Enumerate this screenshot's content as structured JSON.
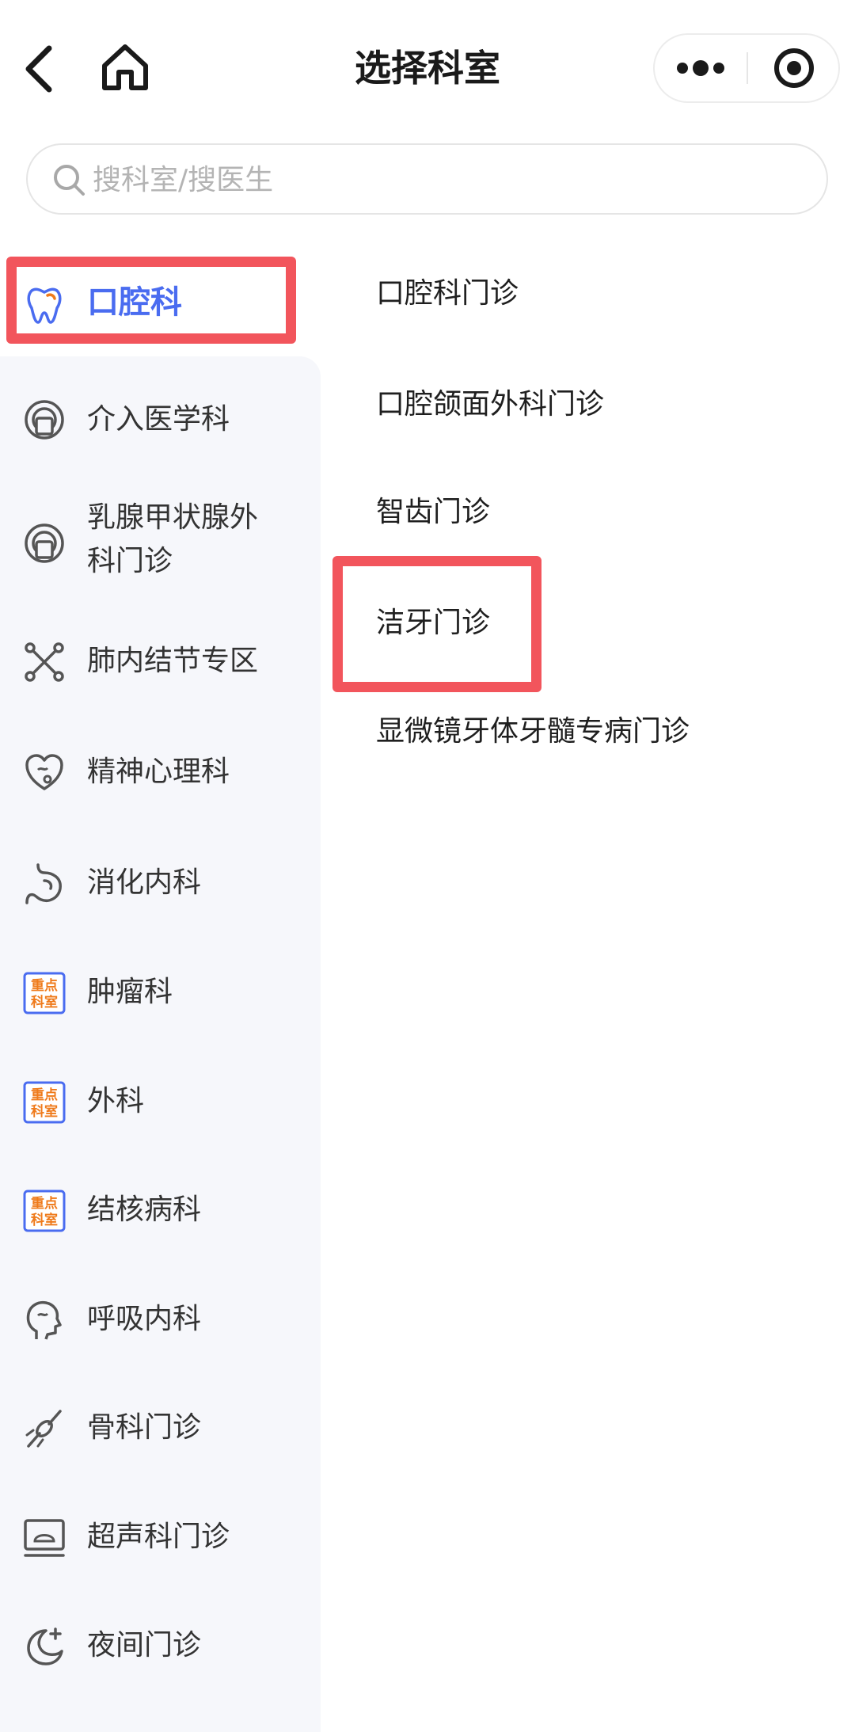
{
  "header": {
    "title": "选择科室"
  },
  "search": {
    "placeholder": "搜科室/搜医生"
  },
  "sidebar": {
    "items": [
      {
        "label": "口腔科",
        "icon": "tooth-icon",
        "active": true
      },
      {
        "label": "介入医学科",
        "icon": "ct-scanner-icon"
      },
      {
        "label": "乳腺甲状腺外科门诊",
        "icon": "ct-scanner-icon"
      },
      {
        "label": "肺内结节专区",
        "icon": "molecule-icon"
      },
      {
        "label": "精神心理科",
        "icon": "heart-brain-icon"
      },
      {
        "label": "消化内科",
        "icon": "stomach-icon"
      },
      {
        "label": "肿瘤科",
        "icon": "key-department-badge-icon"
      },
      {
        "label": "外科",
        "icon": "key-department-badge-icon"
      },
      {
        "label": "结核病科",
        "icon": "key-department-badge-icon"
      },
      {
        "label": "呼吸内科",
        "icon": "head-profile-icon"
      },
      {
        "label": "骨科门诊",
        "icon": "bone-icon"
      },
      {
        "label": "超声科门诊",
        "icon": "ultrasound-monitor-icon"
      },
      {
        "label": "夜间门诊",
        "icon": "moon-plus-icon"
      }
    ],
    "badge_text": [
      "重点",
      "科室"
    ]
  },
  "departments": [
    {
      "label": "口腔科门诊"
    },
    {
      "label": "口腔颌面外科门诊"
    },
    {
      "label": "智齿门诊"
    },
    {
      "label": "洁牙门诊"
    },
    {
      "label": "显微镜牙体牙髓专病门诊"
    }
  ],
  "colors": {
    "accent": "#4a6cf0",
    "highlight": "#f2555c",
    "sidebar_bg": "#f6f7fb",
    "badge": "#ef7a1a"
  }
}
